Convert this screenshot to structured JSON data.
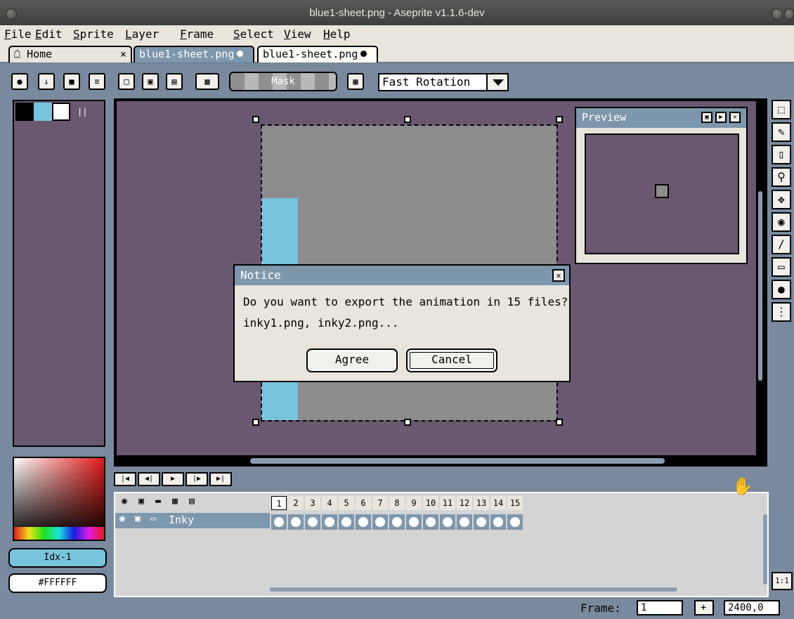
{
  "window": {
    "title": "blue1-sheet.png - Aseprite v1.1.6-dev"
  },
  "menu": [
    "File",
    "Edit",
    "Sprite",
    "Layer",
    "Frame",
    "Select",
    "View",
    "Help"
  ],
  "tabs": [
    {
      "label": "Home",
      "icon": "home-icon",
      "close": "×"
    },
    {
      "label": "blue1-sheet.png",
      "modified": true
    },
    {
      "label": "blue1-sheet.png",
      "modified": true
    }
  ],
  "toolbar": {
    "mask_label": "Mask",
    "rotation_select": "Fast Rotation"
  },
  "preview": {
    "title": "Preview"
  },
  "dialog": {
    "title": "Notice",
    "line1": "Do you want to export the animation in 15 files?",
    "line2": "inky1.png, inky2.png...",
    "agree": "Agree",
    "cancel": "Cancel"
  },
  "color": {
    "index_label": "Idx-1",
    "hex_label": "#FFFFFF",
    "accent": "#79c4dd",
    "canvas_bg": "#6a5870",
    "panel_blue": "#7d97ad"
  },
  "timeline": {
    "layer_name": "Inky",
    "frames": [
      "1",
      "2",
      "3",
      "4",
      "5",
      "6",
      "7",
      "8",
      "9",
      "10",
      "11",
      "12",
      "13",
      "14",
      "15"
    ]
  },
  "status": {
    "frame_label": "Frame:",
    "frame_value": "1",
    "add_label": "+",
    "zoom_value": "2400,0"
  },
  "ratio_label": "1:1"
}
